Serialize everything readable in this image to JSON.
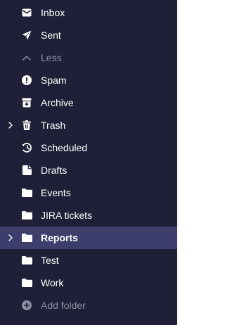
{
  "colors": {
    "sidebar_bg": "#1f2037",
    "selected_bg": "#3d3e6c",
    "text": "#ffffff",
    "muted_text": "#8e8fa3"
  },
  "folders": [
    {
      "label": "Inbox",
      "icon": "envelope-icon"
    },
    {
      "label": "Sent",
      "icon": "paper-plane-icon"
    },
    {
      "label": "Less",
      "icon": "chevron-up-icon",
      "muted": true
    },
    {
      "label": "Spam",
      "icon": "exclamation-circle-icon"
    },
    {
      "label": "Archive",
      "icon": "archive-box-icon"
    },
    {
      "label": "Trash",
      "icon": "trash-icon",
      "expandable": true
    },
    {
      "label": "Scheduled",
      "icon": "clock-icon"
    },
    {
      "label": "Drafts",
      "icon": "draft-file-icon"
    },
    {
      "label": "Events",
      "icon": "folder-icon"
    },
    {
      "label": "JIRA tickets",
      "icon": "folder-icon"
    },
    {
      "label": "Reports",
      "icon": "folder-icon",
      "expandable": true,
      "selected": true
    },
    {
      "label": "Test",
      "icon": "folder-icon"
    },
    {
      "label": "Work",
      "icon": "folder-icon"
    },
    {
      "label": "Add folder",
      "icon": "plus-circle-icon",
      "muted": true
    }
  ]
}
